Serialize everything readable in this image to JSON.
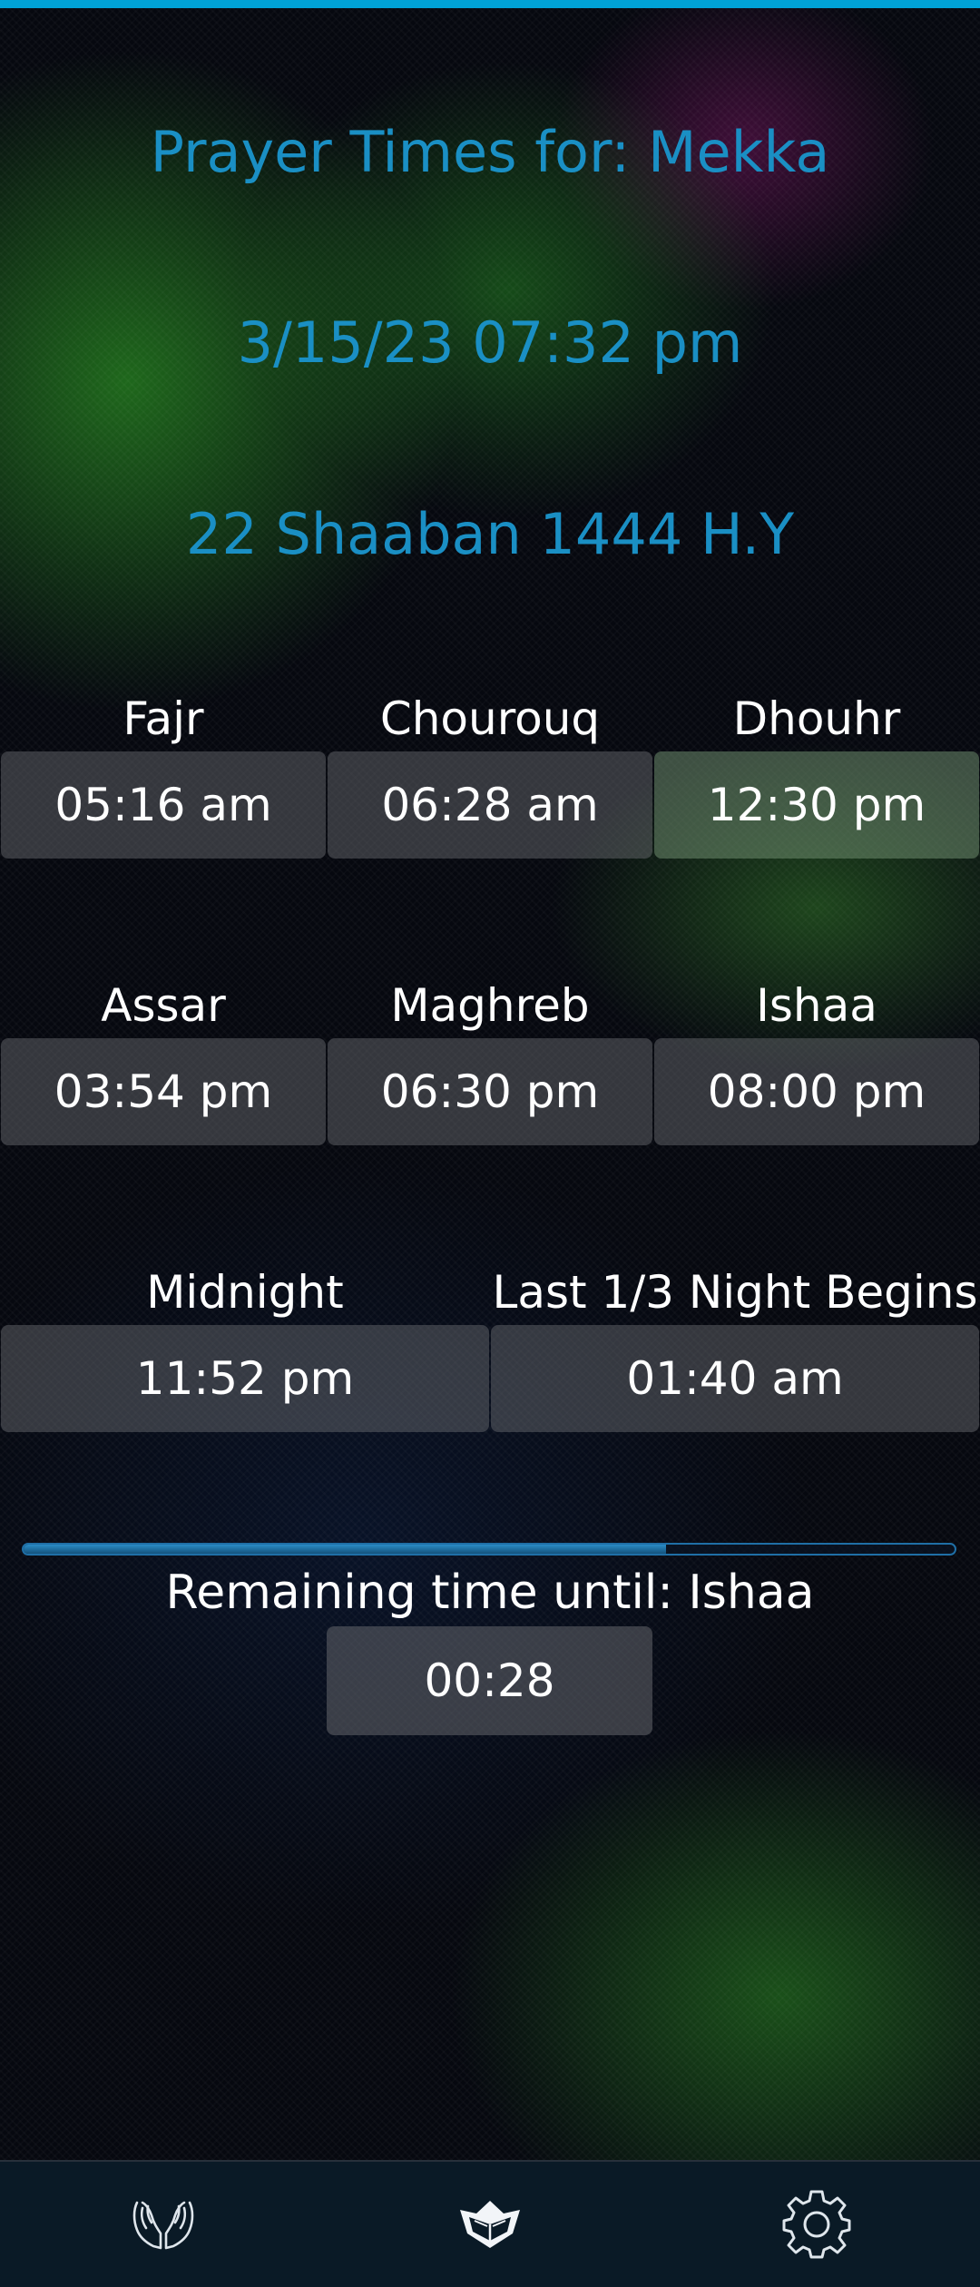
{
  "header": {
    "title": "Prayer Times for: Mekka",
    "datetime": "3/15/23 07:32 pm",
    "hijri_date": "22 Shaaban 1444 H.Y"
  },
  "times": [
    {
      "label": "Fajr",
      "value": "05:16 am"
    },
    {
      "label": "Chourouq",
      "value": "06:28 am"
    },
    {
      "label": "Dhouhr",
      "value": "12:30 pm"
    },
    {
      "label": "Assar",
      "value": "03:54 pm"
    },
    {
      "label": "Maghreb",
      "value": "06:30 pm"
    },
    {
      "label": "Ishaa",
      "value": "08:00 pm"
    },
    {
      "label": "Midnight",
      "value": "11:52 pm"
    },
    {
      "label": "Last 1/3 Night Begins",
      "value": "01:40 am"
    }
  ],
  "countdown": {
    "label": "Remaining time until: Ishaa",
    "value": "00:28",
    "progress_fraction": 0.69
  },
  "nav": {
    "items": [
      {
        "icon": "praying-hands-icon"
      },
      {
        "icon": "quran-book-icon"
      },
      {
        "icon": "gear-icon"
      }
    ]
  },
  "colors": {
    "accent": "#00a2d6",
    "header_text": "#1a8fc4"
  }
}
